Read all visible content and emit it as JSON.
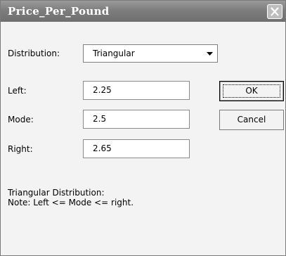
{
  "window": {
    "title": "Price_Per_Pound"
  },
  "distribution": {
    "label": "Distribution:",
    "selected": "Triangular"
  },
  "fields": {
    "left": {
      "label": "Left:",
      "value": "2.25"
    },
    "mode": {
      "label": "Mode:",
      "value": "2.5"
    },
    "right": {
      "label": "Right:",
      "value": "2.65"
    }
  },
  "buttons": {
    "ok_label": "OK",
    "cancel_label": "Cancel"
  },
  "note": {
    "line1": "Triangular Distribution:",
    "line2": "Note: Left <= Mode <= right."
  },
  "icons": {
    "close": "close-icon",
    "dropdown": "chevron-down-icon"
  }
}
